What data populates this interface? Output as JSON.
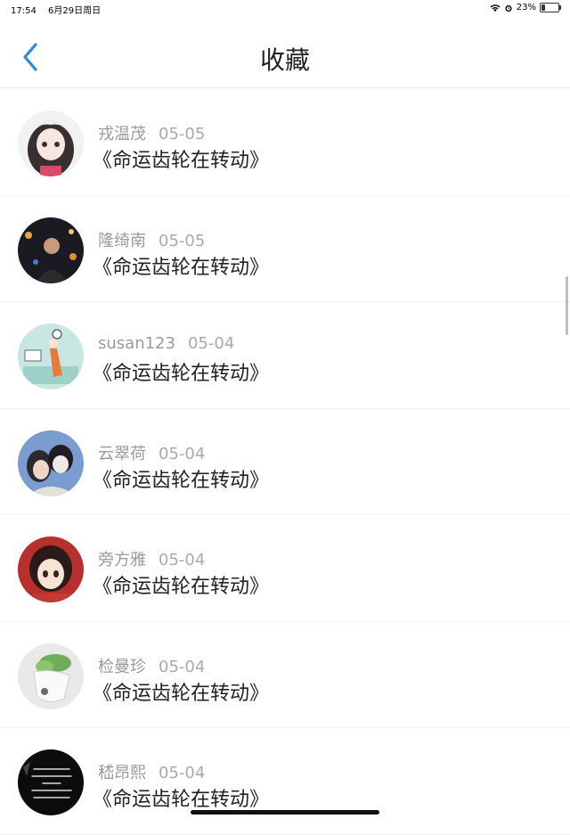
{
  "status": {
    "time": "17:54",
    "date": "6月29日周日",
    "battery": "23%"
  },
  "nav": {
    "title": "收藏"
  },
  "items": [
    {
      "name": "戎温茂",
      "date": "05-05",
      "title": "《命运齿轮在转动》",
      "avatar": "anime-girl"
    },
    {
      "name": "隆绮南",
      "date": "05-05",
      "title": "《命运齿轮在转动》",
      "avatar": "night-portrait"
    },
    {
      "name": "susan123",
      "date": "05-04",
      "title": "《命运齿轮在转动》",
      "avatar": "illustration-bedroom"
    },
    {
      "name": "云翠荷",
      "date": "05-04",
      "title": "《命运齿轮在转动》",
      "avatar": "couple-photo"
    },
    {
      "name": "旁方雅",
      "date": "05-04",
      "title": "《命运齿轮在转动》",
      "avatar": "anime-red-girl"
    },
    {
      "name": "检曼珍",
      "date": "05-04",
      "title": "《命运齿轮在转动》",
      "avatar": "plant-vase"
    },
    {
      "name": "嵇昂熙",
      "date": "05-04",
      "title": "《命运齿轮在转动》",
      "avatar": "black-text"
    }
  ]
}
